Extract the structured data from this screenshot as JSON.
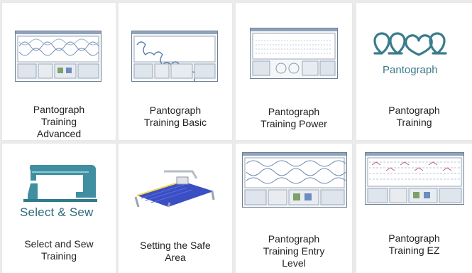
{
  "tiles": [
    {
      "id": "pantograph-training-advanced",
      "caption": "Pantograph\nTraining\nAdvanced",
      "thumb": "software-screenshot"
    },
    {
      "id": "pantograph-training-basic",
      "caption": "Pantograph\nTraining Basic",
      "thumb": "software-screenshot"
    },
    {
      "id": "pantograph-training-power",
      "caption": "Pantograph\nTraining Power",
      "thumb": "software-screenshot"
    },
    {
      "id": "pantograph-training",
      "caption": "Pantograph\nTraining",
      "thumb": "pantograph-logo",
      "logo_text": "Pantograph"
    },
    {
      "id": "select-and-sew-training",
      "caption": "Select and Sew\nTraining",
      "thumb": "sewing-machine-logo",
      "logo_text": "Select & Sew"
    },
    {
      "id": "setting-the-safe-area",
      "caption": "Setting the Safe\nArea",
      "thumb": "quilting-frame-photo"
    },
    {
      "id": "pantograph-training-entry-level",
      "caption": "Pantograph\nTraining Entry\nLevel",
      "thumb": "software-screenshot"
    },
    {
      "id": "pantograph-training-ez",
      "caption": "Pantograph\nTraining EZ",
      "thumb": "software-screenshot"
    }
  ],
  "colors": {
    "accent_teal": "#3a7c8c",
    "marker_red": "#e21c1c",
    "screenshot_border": "#6f7f94"
  }
}
